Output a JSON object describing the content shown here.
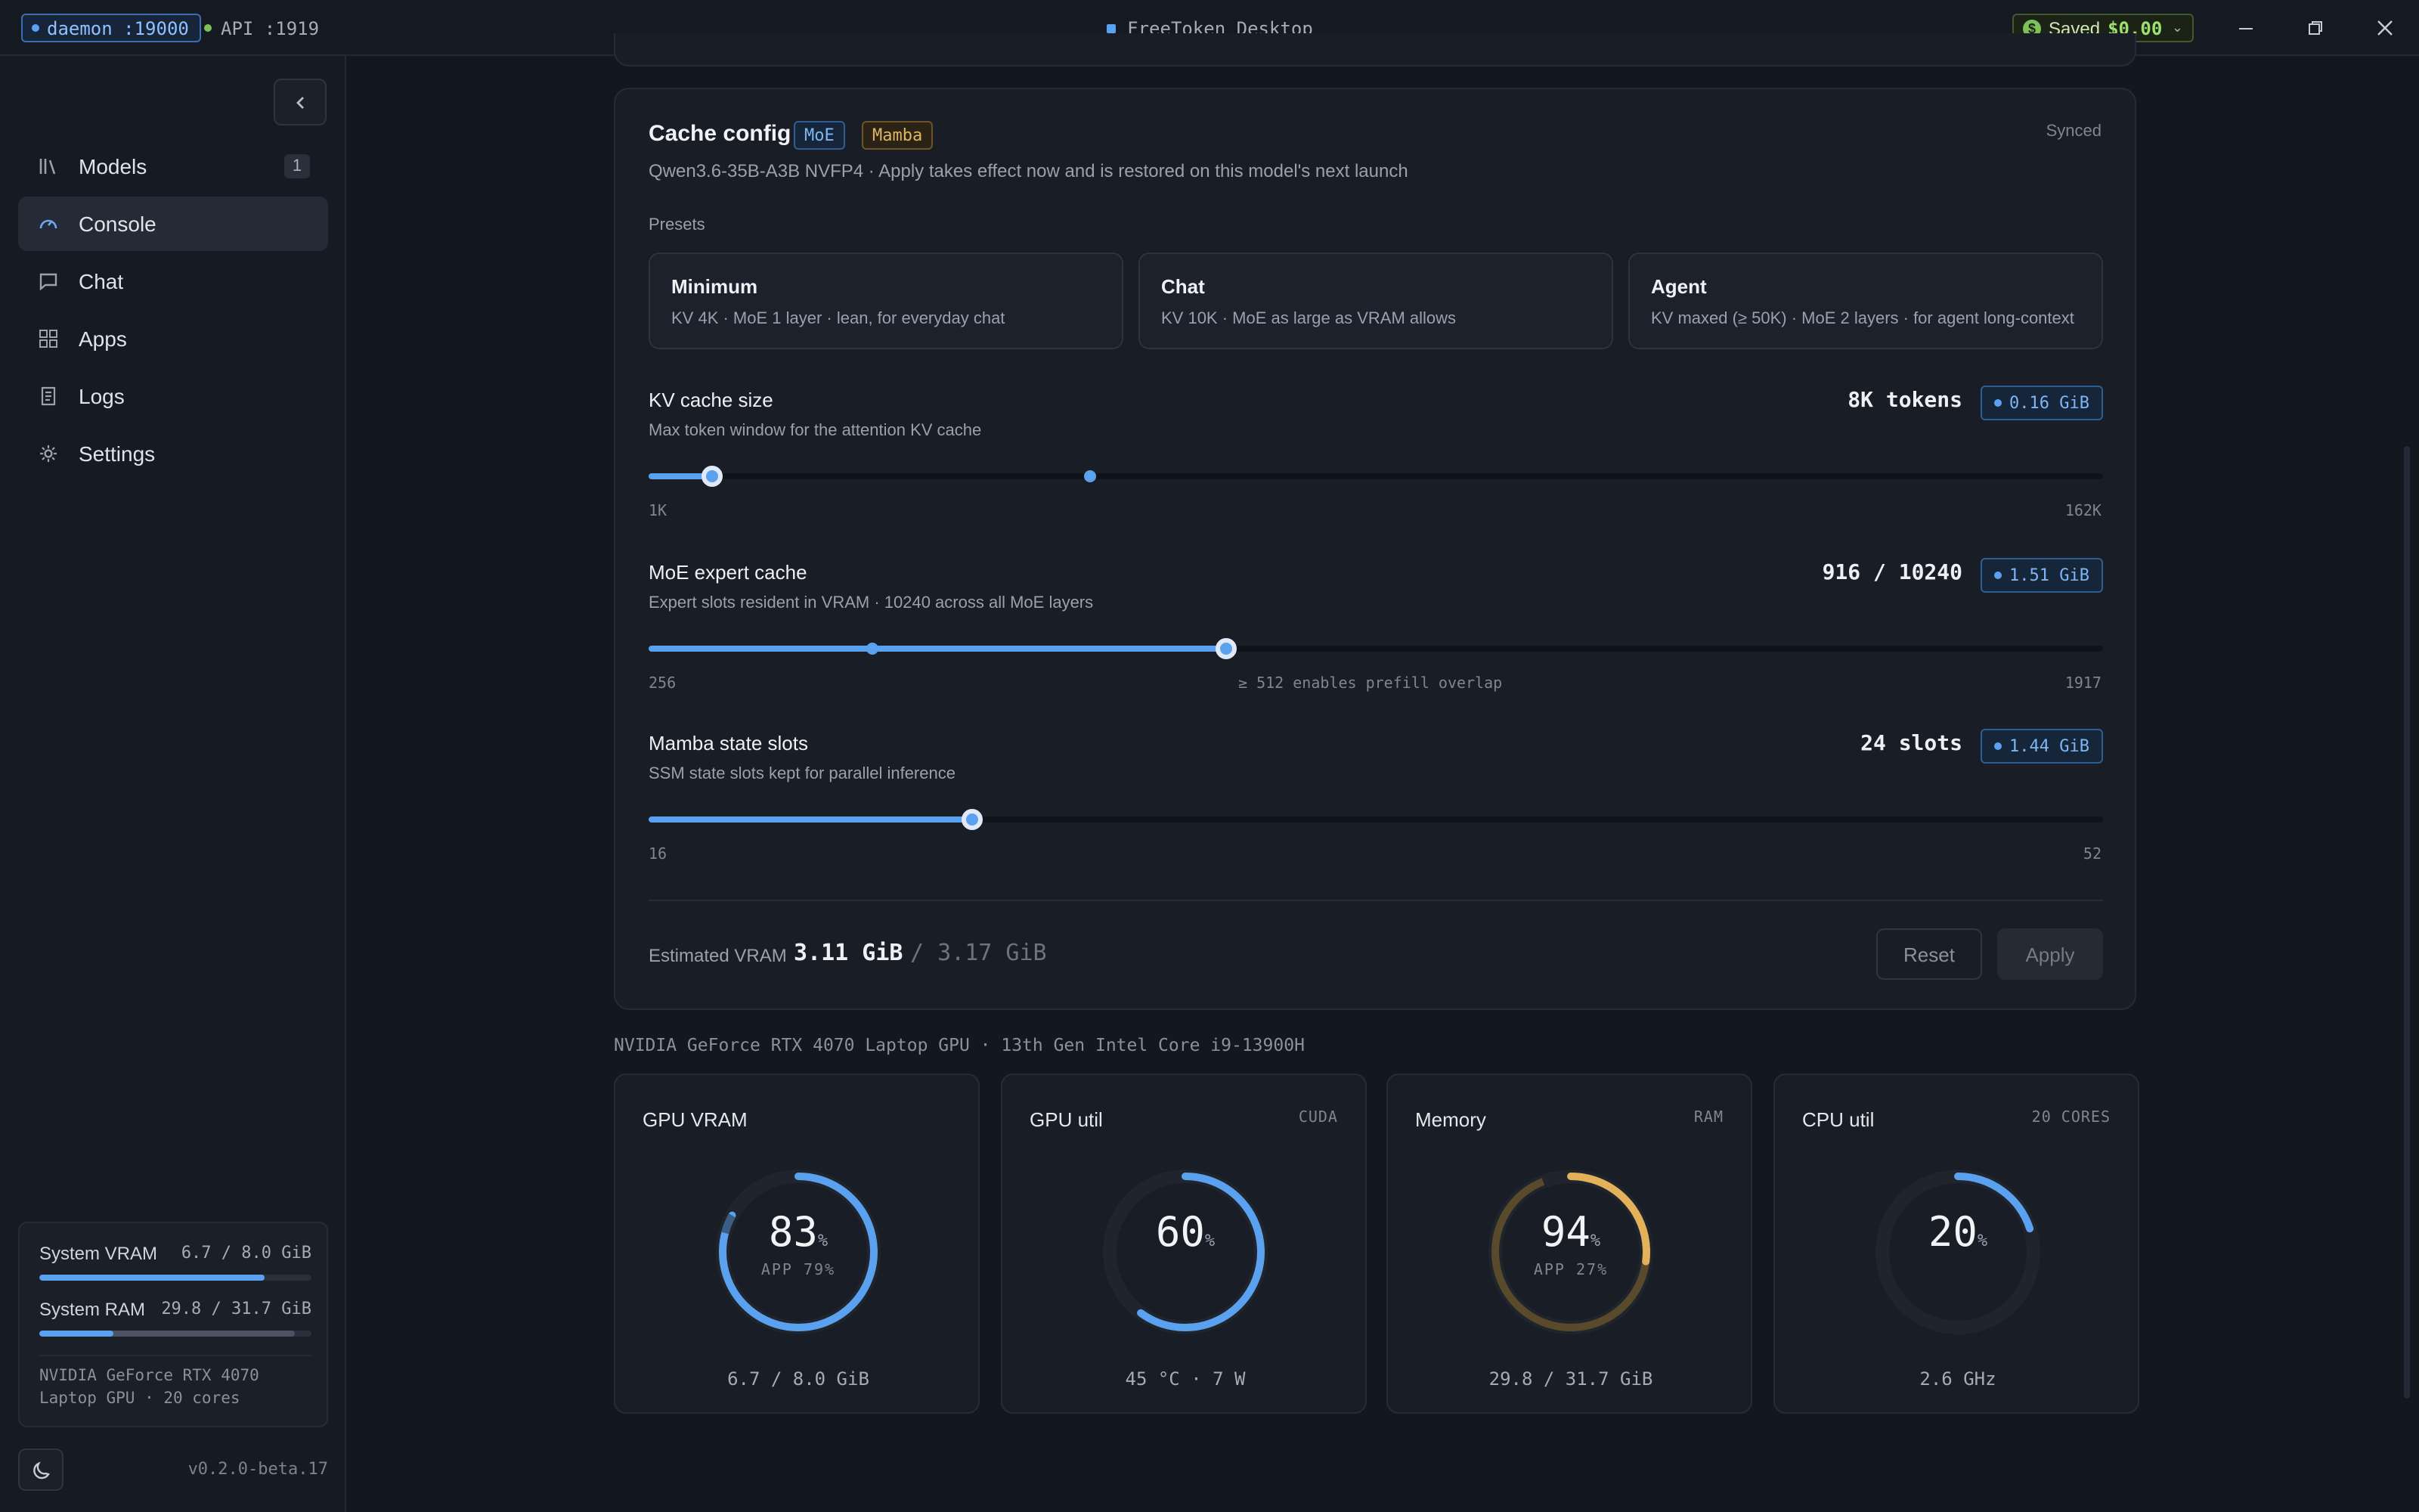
{
  "titlebar": {
    "daemon": "daemon :19000",
    "api": "API :1919",
    "app_title": "FreeToken Desktop",
    "saved_label": "Saved",
    "saved_amount": "$0.00"
  },
  "sidebar": {
    "items": [
      {
        "label": "Models",
        "icon": "library-icon",
        "badge": "1"
      },
      {
        "label": "Console",
        "icon": "gauge-icon",
        "active": true
      },
      {
        "label": "Chat",
        "icon": "chat-icon"
      },
      {
        "label": "Apps",
        "icon": "grid-icon"
      },
      {
        "label": "Logs",
        "icon": "logs-icon"
      },
      {
        "label": "Settings",
        "icon": "settings-icon"
      }
    ],
    "system": {
      "vram_label": "System VRAM",
      "vram_value": "6.7 / 8.0 GiB",
      "vram_fraction": 0.83,
      "ram_label": "System RAM",
      "ram_value": "29.8 / 31.7 GiB",
      "ram_fraction": 0.94,
      "gpu_text": "NVIDIA GeForce RTX 4070 Laptop GPU · 20 cores"
    },
    "version": "v0.2.0-beta.17"
  },
  "cache_config": {
    "title": "Cache config",
    "tags": [
      "MoE",
      "Mamba"
    ],
    "status": "Synced",
    "subtitle": "Qwen3.6-35B-A3B NVFP4 · Apply takes effect now and is restored on this model's next launch",
    "presets_label": "Presets",
    "presets": [
      {
        "name": "Minimum",
        "desc": "KV 4K · MoE 1 layer · lean, for everyday chat"
      },
      {
        "name": "Chat",
        "desc": "KV 10K · MoE as large as VRAM allows"
      },
      {
        "name": "Agent",
        "desc": "KV maxed (≥ 50K) · MoE 2 layers · for agent long-context"
      }
    ],
    "params": [
      {
        "title": "KV cache size",
        "desc": "Max token window for the attention KV cache",
        "value": "8K tokens",
        "gib": "0.16 GiB",
        "min": "1K",
        "max": "162K",
        "fraction": 0.044,
        "marker": 0.304,
        "hint": ""
      },
      {
        "title": "MoE expert cache",
        "desc": "Expert slots resident in VRAM · 10240 across all MoE layers",
        "value": "916 / 10240",
        "gib": "1.51 GiB",
        "min": "256",
        "max": "1917",
        "fraction": 0.397,
        "marker": 0.154,
        "hint": "≥ 512 enables prefill overlap"
      },
      {
        "title": "Mamba state slots",
        "desc": "SSM state slots kept for parallel inference",
        "value": "24 slots",
        "gib": "1.44 GiB",
        "min": "16",
        "max": "52",
        "fraction": 0.222,
        "hint": ""
      }
    ],
    "estimated_label": "Estimated VRAM",
    "estimated_value": "3.11 GiB",
    "estimated_total": "/ 3.17 GiB",
    "reset_label": "Reset",
    "apply_label": "Apply"
  },
  "hardware_line": "NVIDIA GeForce RTX 4070 Laptop GPU · 13th Gen Intel Core i9-13900H",
  "gauges": [
    {
      "title": "GPU VRAM",
      "tag": "",
      "value": "83",
      "unit": "%",
      "sub": "APP 79%",
      "footer": "6.7 / 8.0 GiB",
      "fraction": 0.83,
      "app_fraction": 0.79,
      "color": "#5aa2f0"
    },
    {
      "title": "GPU util",
      "tag": "CUDA",
      "value": "60",
      "unit": "%",
      "sub": "",
      "footer": "45 °C · 7 W",
      "fraction": 0.6,
      "color": "#5aa2f0"
    },
    {
      "title": "Memory",
      "tag": "RAM",
      "value": "94",
      "unit": "%",
      "sub": "APP 27%",
      "footer": "29.8 / 31.7 GiB",
      "fraction": 0.94,
      "app_fraction": 0.27,
      "color": "#e3b15a"
    },
    {
      "title": "CPU util",
      "tag": "20 CORES",
      "value": "20",
      "unit": "%",
      "sub": "",
      "footer": "2.6 GHz",
      "fraction": 0.2,
      "color": "#5aa2f0"
    }
  ]
}
